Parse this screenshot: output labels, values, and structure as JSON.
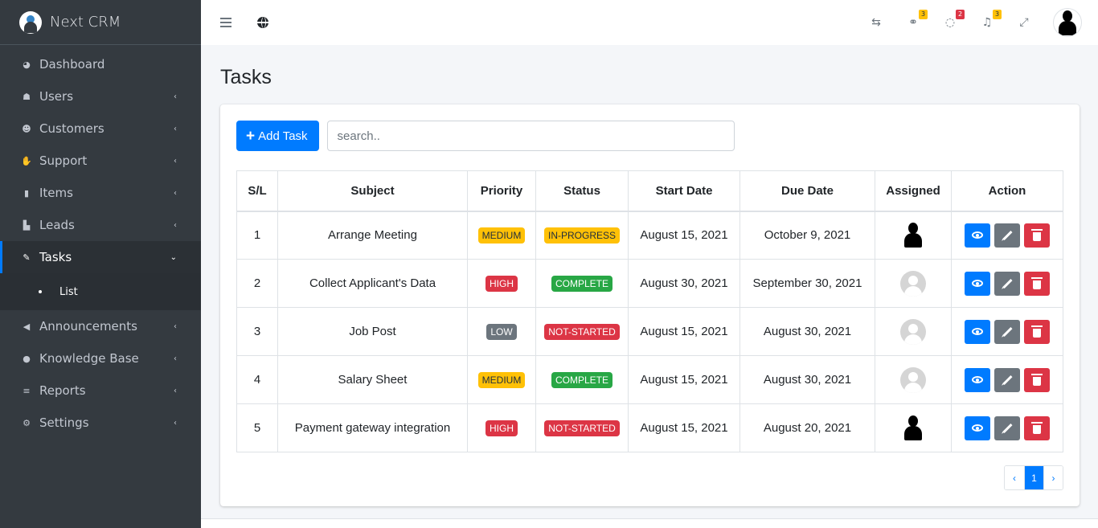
{
  "brand": {
    "name": "Next CRM"
  },
  "sidebar": {
    "items": [
      {
        "label": "Dashboard",
        "icon": "dashboard-icon",
        "chevron": false
      },
      {
        "label": "Users",
        "icon": "user-icon",
        "chevron": true
      },
      {
        "label": "Customers",
        "icon": "users-group-icon",
        "chevron": true
      },
      {
        "label": "Support",
        "icon": "handshake-icon",
        "chevron": true
      },
      {
        "label": "Items",
        "icon": "book-icon",
        "chevron": true
      },
      {
        "label": "Leads",
        "icon": "lead-icon",
        "chevron": true
      },
      {
        "label": "Tasks",
        "icon": "edit-icon",
        "chevron": true,
        "active": true
      },
      {
        "label": "Announcements",
        "icon": "megaphone-icon",
        "chevron": true
      },
      {
        "label": "Knowledge Base",
        "icon": "info-icon",
        "chevron": true
      },
      {
        "label": "Reports",
        "icon": "list-icon",
        "chevron": true
      },
      {
        "label": "Settings",
        "icon": "cogs-icon",
        "chevron": true
      }
    ],
    "sub_item": "List"
  },
  "topbar": {
    "badges": {
      "support": "3",
      "messages": "2",
      "notifications": "3"
    }
  },
  "page": {
    "title": "Tasks"
  },
  "toolbar": {
    "add_label": "Add Task",
    "search_placeholder": "search.."
  },
  "table": {
    "headers": [
      "S/L",
      "Subject",
      "Priority",
      "Status",
      "Start Date",
      "Due Date",
      "Assigned",
      "Action"
    ],
    "rows": [
      {
        "sl": "1",
        "subject": "Arrange Meeting",
        "priority": "MEDIUM",
        "status": "IN-PROGRESS",
        "start": "August 15, 2021",
        "due": "October 9, 2021",
        "assigned": "dark"
      },
      {
        "sl": "2",
        "subject": "Collect Applicant's Data",
        "priority": "HIGH",
        "status": "COMPLETE",
        "start": "August 30, 2021",
        "due": "September 30, 2021",
        "assigned": "grey"
      },
      {
        "sl": "3",
        "subject": "Job Post",
        "priority": "LOW",
        "status": "NOT-STARTED",
        "start": "August 15, 2021",
        "due": "August 30, 2021",
        "assigned": "grey"
      },
      {
        "sl": "4",
        "subject": "Salary Sheet",
        "priority": "MEDIUM",
        "status": "COMPLETE",
        "start": "August 15, 2021",
        "due": "August 30, 2021",
        "assigned": "grey"
      },
      {
        "sl": "5",
        "subject": "Payment gateway integration",
        "priority": "HIGH",
        "status": "NOT-STARTED",
        "start": "August 15, 2021",
        "due": "August 20, 2021",
        "assigned": "dark"
      }
    ]
  },
  "pagination": {
    "current": "1"
  },
  "colors": {
    "primary": "#007bff",
    "sidebar": "#343a40",
    "warning": "#ffc107",
    "danger": "#dc3545",
    "success": "#28a745",
    "secondary": "#6c757d"
  }
}
